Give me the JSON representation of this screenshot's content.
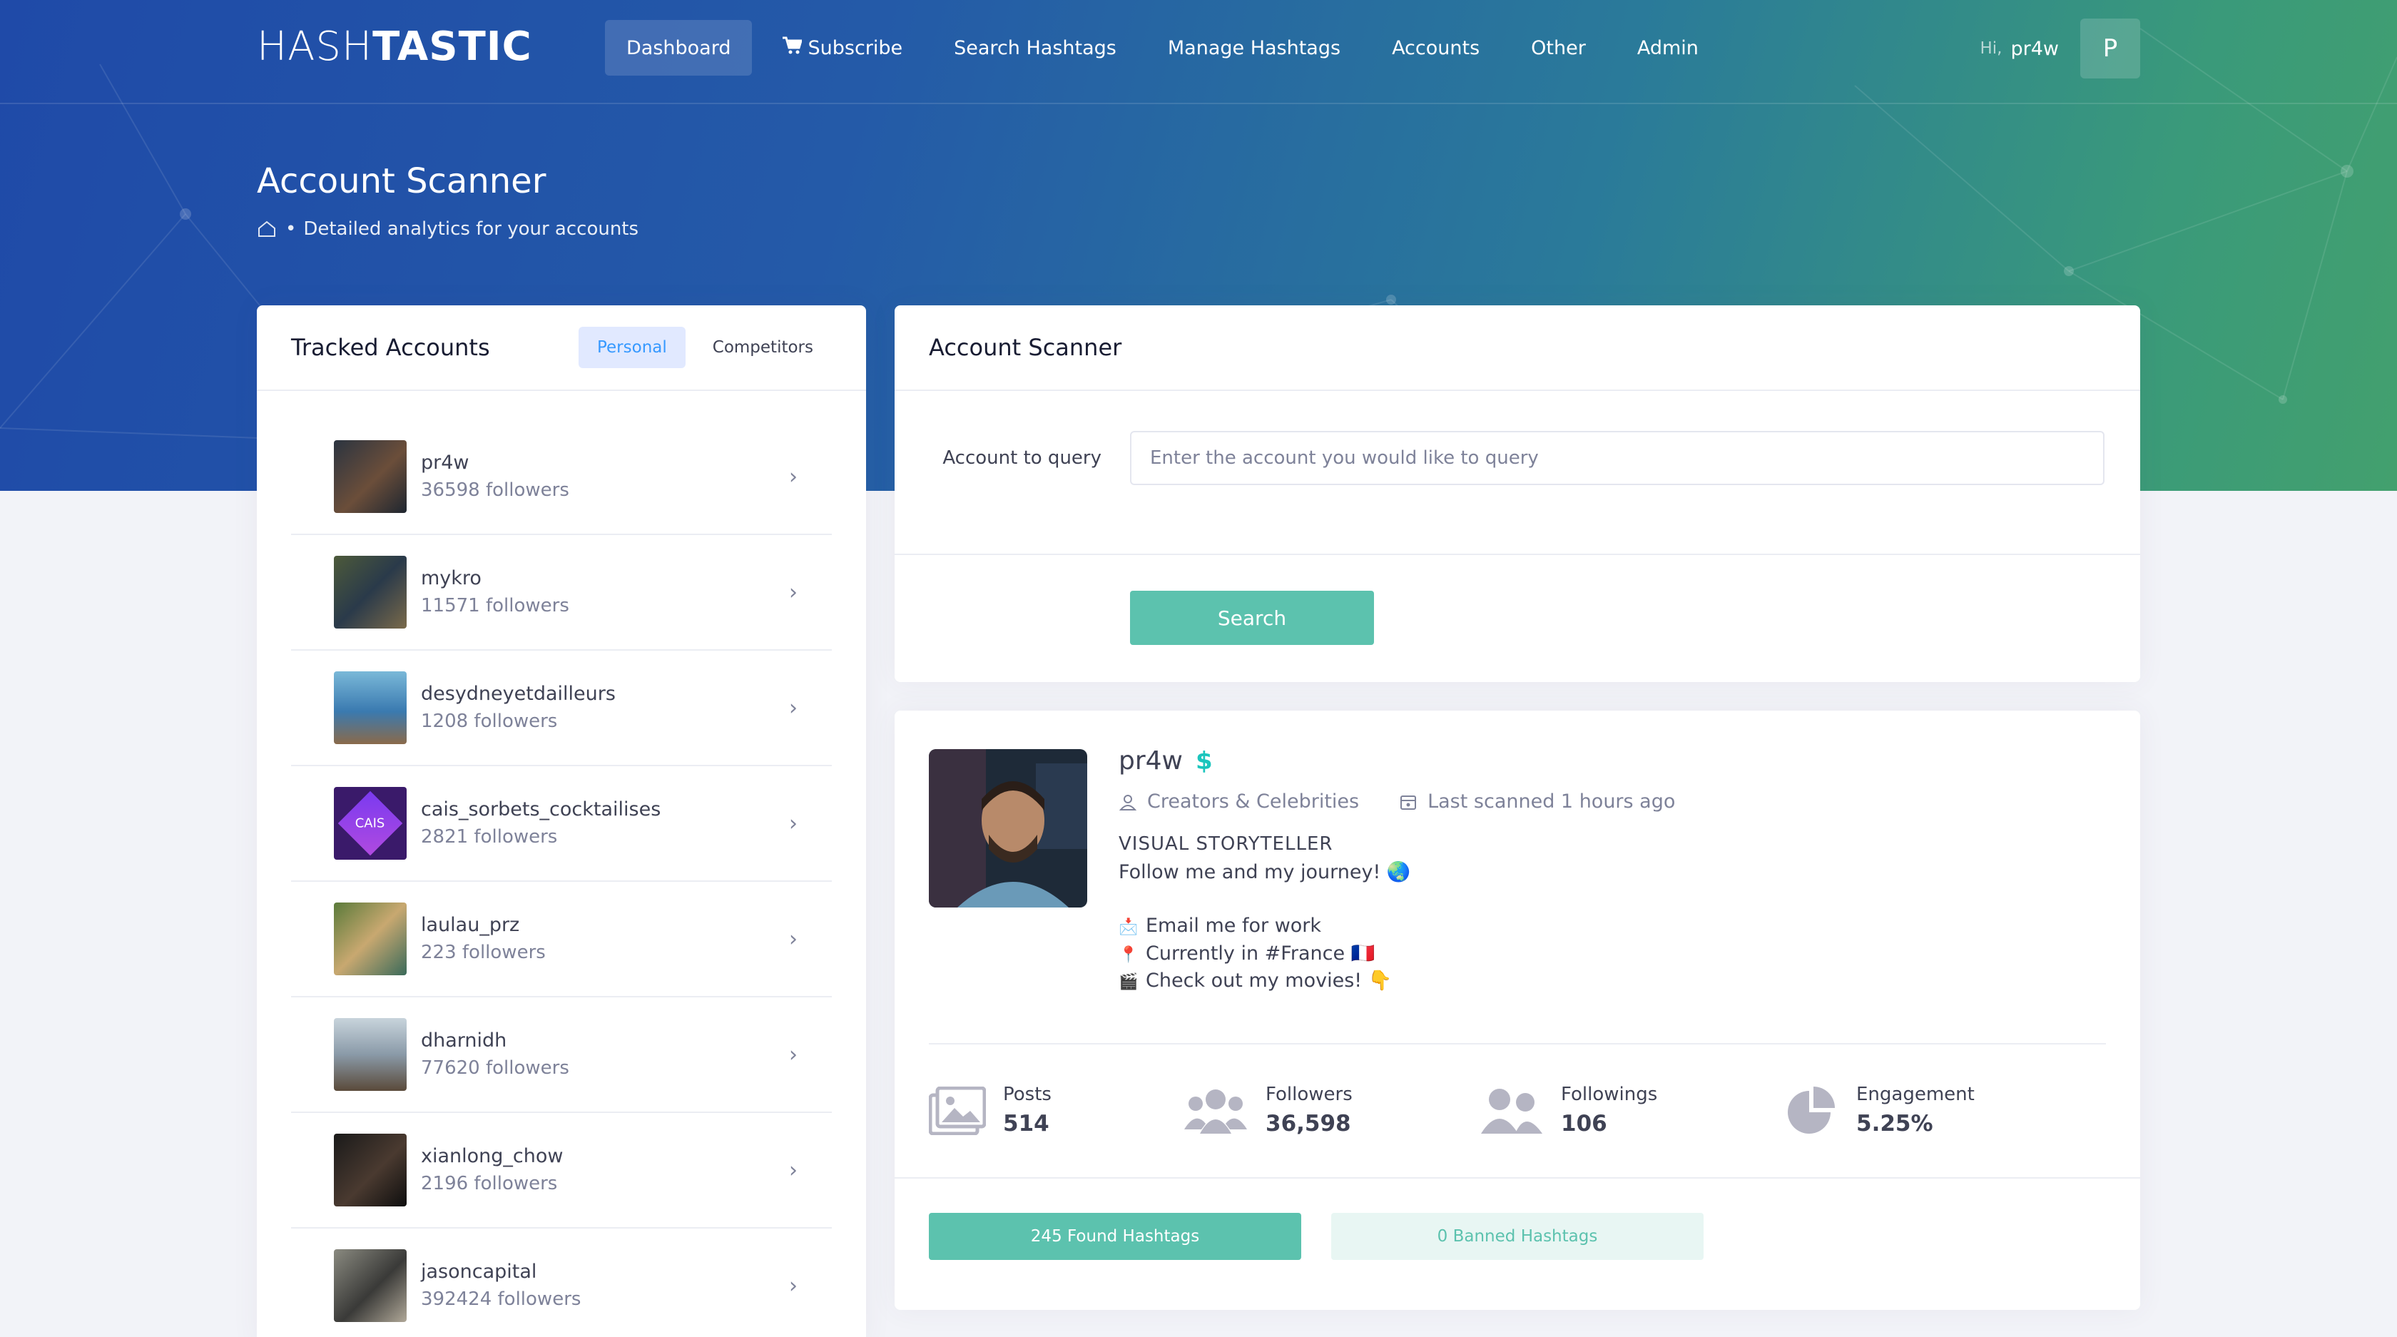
{
  "app": {
    "logo_light": "HASH",
    "logo_bold": "TASTIC"
  },
  "nav": {
    "items": [
      "Dashboard",
      "Subscribe",
      "Search Hashtags",
      "Manage Hashtags",
      "Accounts",
      "Other",
      "Admin"
    ],
    "active": "Dashboard"
  },
  "user": {
    "greeting": "Hi,",
    "name": "pr4w",
    "avatar_letter": "P"
  },
  "page": {
    "title": "Account Scanner",
    "subtitle": "Detailed analytics for your accounts"
  },
  "tracked": {
    "title": "Tracked Accounts",
    "tabs": [
      "Personal",
      "Competitors"
    ],
    "active_tab": "Personal",
    "accounts": [
      {
        "name": "pr4w",
        "followers": "36598 followers"
      },
      {
        "name": "mykro",
        "followers": "11571 followers"
      },
      {
        "name": "desydneyetdailleurs",
        "followers": "1208 followers"
      },
      {
        "name": "cais_sorbets_cocktailises",
        "followers": "2821 followers"
      },
      {
        "name": "laulau_prz",
        "followers": "223 followers"
      },
      {
        "name": "dharnidh",
        "followers": "77620 followers"
      },
      {
        "name": "xianlong_chow",
        "followers": "2196 followers"
      },
      {
        "name": "jasoncapital",
        "followers": "392424 followers"
      }
    ]
  },
  "scanner": {
    "title": "Account Scanner",
    "field_label": "Account to query",
    "placeholder": "Enter the account you would like to query",
    "value": "",
    "search_label": "Search"
  },
  "profile": {
    "name": "pr4w",
    "category": "Creators & Celebrities",
    "last_scanned": "Last scanned 1 hours ago",
    "bio_title": "VISUAL STORYTELLER",
    "bio_lines": [
      "Follow me and my journey! 🌏",
      "Email me for work",
      "Currently in #France 🇫🇷",
      "Check out my movies! 👇"
    ],
    "stats": [
      {
        "label": "Posts",
        "value": "514",
        "icon": "images-icon"
      },
      {
        "label": "Followers",
        "value": "36,598",
        "icon": "users-icon"
      },
      {
        "label": "Followings",
        "value": "106",
        "icon": "user-friends-icon"
      },
      {
        "label": "Engagement",
        "value": "5.25%",
        "icon": "pie-chart-icon"
      }
    ],
    "found_hashtags": "245 Found Hashtags",
    "banned_hashtags": "0 Banned Hashtags"
  },
  "colors": {
    "accent": "#5cc2ae",
    "hero_start": "#1f4aa8",
    "hero_end": "#43a06e",
    "tab_active_bg": "#e1e9ff",
    "tab_active_text": "#3699ff"
  }
}
